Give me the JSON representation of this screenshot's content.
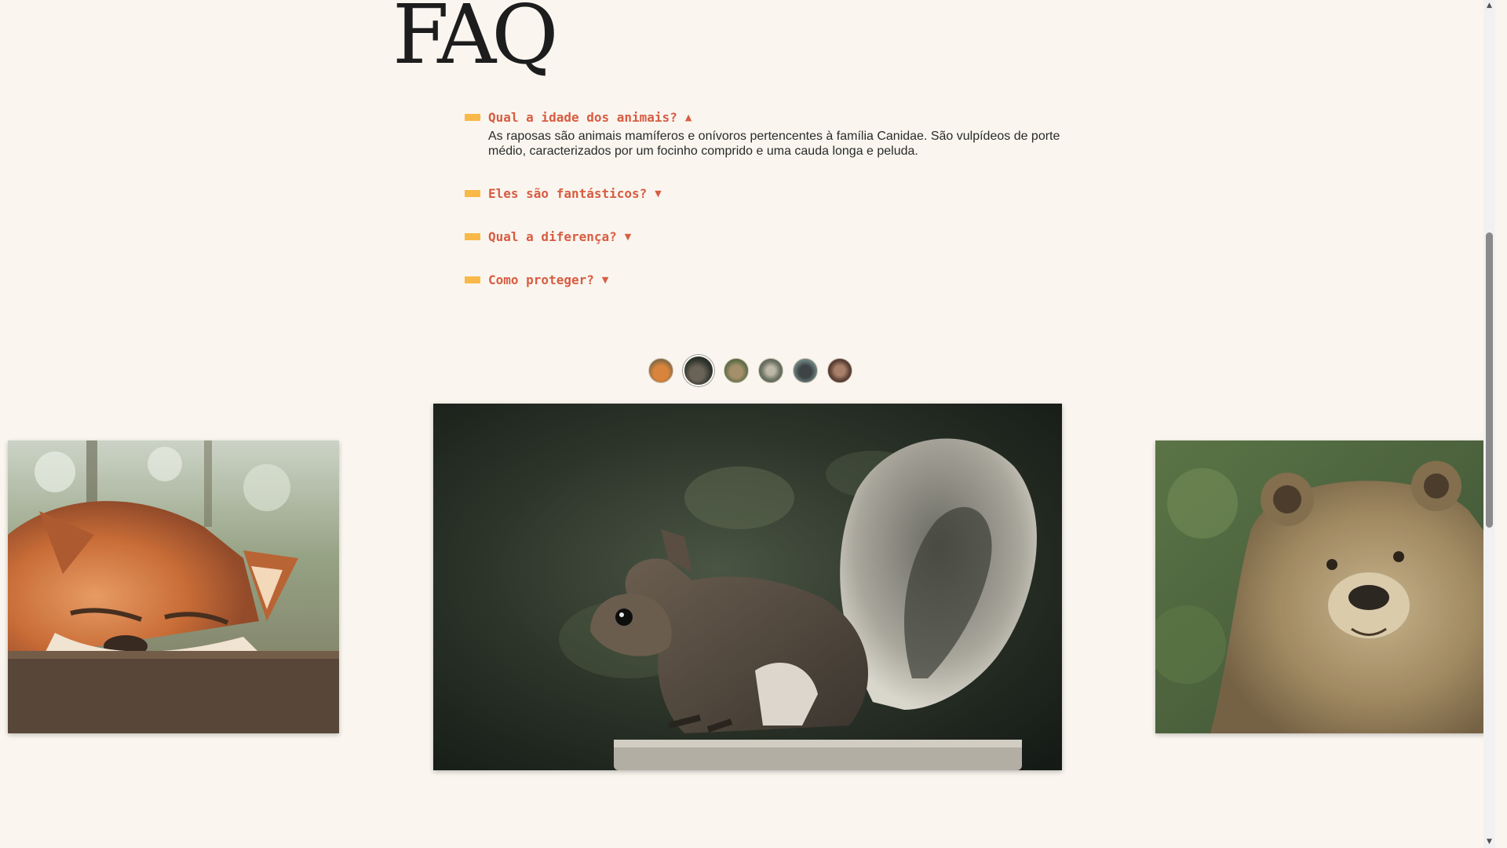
{
  "faq": {
    "title": "FAQ",
    "items": [
      {
        "question": "Qual a idade dos animais?",
        "arrow": "▲",
        "answer": "As raposas são animais mamíferos e onívoros pertencentes à família Canidae. São vulpídeos de porte médio, caracterizados por um focinho comprido e uma cauda longa e peluda.",
        "expanded": true
      },
      {
        "question": "Eles são fantásticos?",
        "arrow": "▼",
        "expanded": false
      },
      {
        "question": "Qual a diferença?",
        "arrow": "▼",
        "expanded": false
      },
      {
        "question": "Como proteger?",
        "arrow": "▼",
        "expanded": false
      }
    ]
  },
  "gallery": {
    "thumbnails": [
      {
        "name": "fox",
        "color": "#c8743a"
      },
      {
        "name": "squirrel",
        "color": "#3c4236",
        "active": true
      },
      {
        "name": "bear",
        "color": "#6d7a55"
      },
      {
        "name": "wolf",
        "color": "#6b6f62"
      },
      {
        "name": "gorilla",
        "color": "#5d6a6e"
      },
      {
        "name": "monkey",
        "color": "#7d5c4e"
      }
    ],
    "slides": {
      "previous": "fox",
      "current": "squirrel",
      "next": "bear"
    }
  },
  "colors": {
    "background": "#faf6ef",
    "accent": "#d85c42",
    "bar": "#f9b949"
  }
}
